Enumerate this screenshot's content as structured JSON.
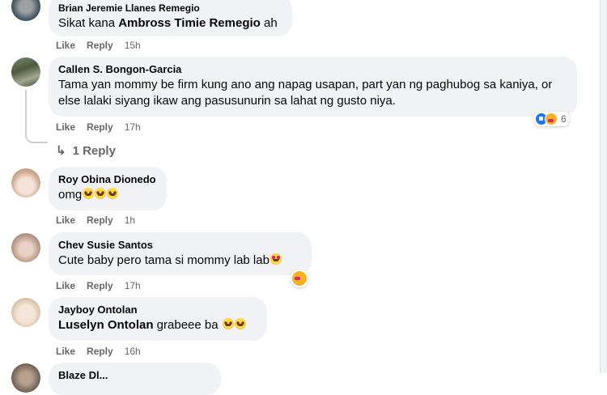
{
  "comments": [
    {
      "author": "Brian Jeremie Llanes Remegio",
      "text_plain": "Sikat kana ",
      "text_mention": "Ambross Timie Remegio",
      "text_suffix": " ah",
      "like_label": "Like",
      "reply_label": "Reply",
      "time": "15h"
    },
    {
      "author": "Callen S. Bongon-Garcia",
      "text": "Tama yan mommy be firm kung ano ang napag usapan, part yan ng paghubog sa kaniya, or else lalaki siyang ikaw ang pasusunurin sa lahat ng gusto niya.",
      "like_label": "Like",
      "reply_label": "Reply",
      "time": "17h",
      "reaction_count": "6",
      "replies_link": "1 Reply"
    },
    {
      "author": "Roy Obina Dionedo",
      "text": "omg",
      "like_label": "Like",
      "reply_label": "Reply",
      "time": "1h"
    },
    {
      "author": "Chev Susie Santos",
      "text": "Cute baby pero tama si mommy lab lab",
      "like_label": "Like",
      "reply_label": "Reply",
      "time": "17h"
    },
    {
      "author": "Jayboy Ontolan",
      "text_mention": "Luselyn Ontolan",
      "text_suffix": " grabeee ba ",
      "like_label": "Like",
      "reply_label": "Reply",
      "time": "16h"
    },
    {
      "author": "Blaze Dl..."
    }
  ],
  "icons": {
    "reply_arrow": "reply-arrow-icon",
    "like_reaction": "like-reaction-icon",
    "care_reaction": "care-reaction-icon",
    "laughing_emoji": "rofl-emoji-icon",
    "heart_eyes_emoji": "heart-eyes-emoji-icon",
    "crying_emoji": "pleading-emoji-icon"
  },
  "colors": {
    "bubble_bg": "#f0f2f5",
    "secondary_text": "#65676b",
    "like_blue": "#1877f2"
  }
}
